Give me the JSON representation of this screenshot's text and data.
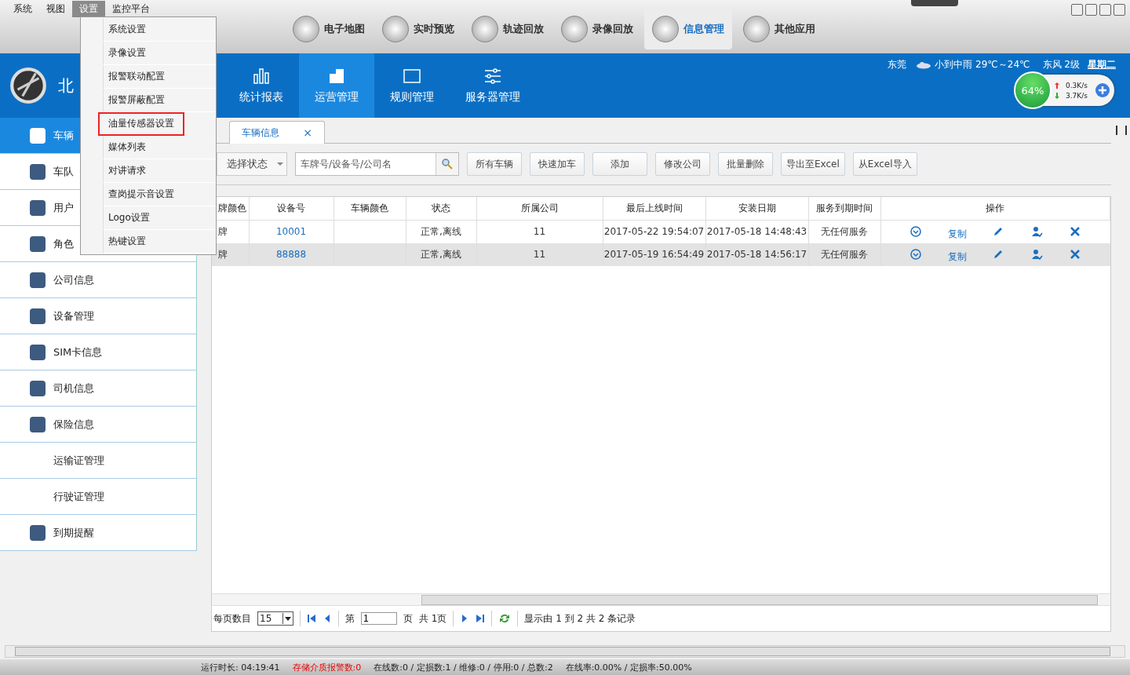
{
  "menubar": [
    {
      "label": "系统",
      "selected": false
    },
    {
      "label": "视图",
      "selected": false
    },
    {
      "label": "设置",
      "selected": true
    },
    {
      "label": "监控平台",
      "selected": false
    }
  ],
  "settings_menu": [
    {
      "label": "系统设置",
      "selected": false
    },
    {
      "label": "录像设置",
      "selected": false
    },
    {
      "label": "报警联动配置",
      "selected": false
    },
    {
      "label": "报警屏蔽配置",
      "selected": false
    },
    {
      "label": "油量传感器设置",
      "selected": true
    },
    {
      "label": "媒体列表",
      "selected": false
    },
    {
      "label": "对讲请求",
      "selected": false
    },
    {
      "label": "查岗提示音设置",
      "selected": false
    },
    {
      "label": "Logo设置",
      "selected": false
    },
    {
      "label": "热键设置",
      "selected": false
    }
  ],
  "modules": [
    {
      "label": "电子地图",
      "selected": false
    },
    {
      "label": "实时预览",
      "selected": false
    },
    {
      "label": "轨迹回放",
      "selected": false
    },
    {
      "label": "录像回放",
      "selected": false
    },
    {
      "label": "信息管理",
      "selected": true
    },
    {
      "label": "其他应用",
      "selected": false
    }
  ],
  "brand": {
    "title": "北"
  },
  "sub_tabs": [
    {
      "label": "统计报表",
      "selected": false
    },
    {
      "label": "运营管理",
      "selected": true
    },
    {
      "label": "规则管理",
      "selected": false
    },
    {
      "label": "服务器管理",
      "selected": false
    }
  ],
  "weather": {
    "city": "东莞",
    "forecast": "小到中雨 29℃～24℃",
    "wind": "东风 2级",
    "weekday": "星期二"
  },
  "network_widget": {
    "percent": "64%",
    "upload": "0.3K/s",
    "download": "3.7K/s"
  },
  "sidebar": [
    {
      "label": "车辆",
      "kind": "icon",
      "selected": true
    },
    {
      "label": "车队",
      "kind": "icon",
      "selected": false
    },
    {
      "label": "用户",
      "kind": "icon",
      "selected": false
    },
    {
      "label": "角色",
      "kind": "icon",
      "selected": false
    },
    {
      "label": "公司信息",
      "kind": "icon",
      "selected": false
    },
    {
      "label": "设备管理",
      "kind": "icon",
      "selected": false
    },
    {
      "label": "SIM卡信息",
      "kind": "icon",
      "selected": false
    },
    {
      "label": "司机信息",
      "kind": "icon",
      "selected": false
    },
    {
      "label": "保险信息",
      "kind": "icon",
      "selected": false
    },
    {
      "label": "运输证管理",
      "kind": "plain",
      "selected": false
    },
    {
      "label": "行驶证管理",
      "kind": "plain",
      "selected": false
    },
    {
      "label": "到期提醒",
      "kind": "icon",
      "selected": false
    }
  ],
  "content_tabs": [
    {
      "label": "车辆信息",
      "close": "×",
      "selected": true
    }
  ],
  "toolbar": {
    "status_select": "选择状态",
    "search_placeholder": "车牌号/设备号/公司名",
    "buttons": [
      "所有车辆",
      "快速加车",
      "添加",
      "修改公司",
      "批量删除",
      "导出至Excel",
      "从Excel导入"
    ]
  },
  "table": {
    "columns": [
      "牌颜色",
      "设备号",
      "车辆颜色",
      "状态",
      "所属公司",
      "最后上线时间",
      "安装日期",
      "服务到期时间",
      "操作"
    ],
    "rows": [
      {
        "cells": [
          "牌",
          "10001",
          "",
          "正常,离线",
          "11",
          "2017-05-22 19:54:07",
          "2017-05-18 14:48:43",
          "无任何服务"
        ],
        "copy": "复制",
        "selected": false
      },
      {
        "cells": [
          "牌",
          "88888",
          "",
          "正常,离线",
          "11",
          "2017-05-19 16:54:49",
          "2017-05-18 14:56:17",
          "无任何服务"
        ],
        "copy": "复制",
        "selected": true
      }
    ]
  },
  "pager": {
    "per_page_label": "每页数目",
    "per_page": "15",
    "page_prefix": "第",
    "page": "1",
    "page_suffix": "页",
    "total_pages": "共 1页",
    "summary": "显示由 1 到 2 共 2 条记录"
  },
  "status_bar": {
    "runtime": "运行时长: 04:19:41",
    "storage_alarm": "存储介质报警数:0",
    "counts": "在线数:0 / 定损数:1 / 维修:0 / 停用:0 / 总数:2",
    "rates": "在线率:0.00% / 定损率:50.00%"
  }
}
